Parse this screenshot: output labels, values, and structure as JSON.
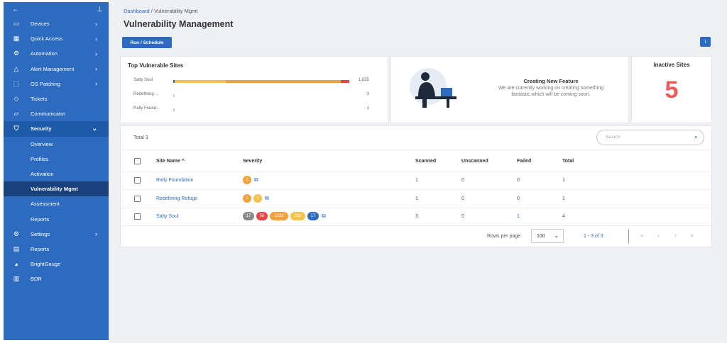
{
  "sidebar": {
    "items": [
      {
        "label": "Devices",
        "icon": "monitor-icon",
        "glyph": "▭",
        "chevron": true
      },
      {
        "label": "Quick Access",
        "icon": "grid-icon",
        "glyph": "▦",
        "chevron": true
      },
      {
        "label": "Automation",
        "icon": "automation-icon",
        "glyph": "⚙",
        "chevron": true
      },
      {
        "label": "Alert Management",
        "icon": "warning-icon",
        "glyph": "△",
        "chevron": true
      },
      {
        "label": "OS Patching",
        "icon": "patch-icon",
        "glyph": "⬚",
        "chevron": true
      },
      {
        "label": "Tickets",
        "icon": "ticket-icon",
        "glyph": "◇",
        "chevron": false
      },
      {
        "label": "Communicator",
        "icon": "chat-icon",
        "glyph": "▱",
        "chevron": false
      }
    ],
    "security": {
      "label": "Security",
      "icon": "shield-icon",
      "glyph": "⛉"
    },
    "security_sub": [
      "Overview",
      "Profiles",
      "Activation",
      "Vulnerability Mgmt",
      "Assessment",
      "Reports"
    ],
    "bottom_items": [
      {
        "label": "Settings",
        "icon": "settings-icon",
        "glyph": "⚙",
        "chevron": true
      },
      {
        "label": "Reports",
        "icon": "report-icon",
        "glyph": "▤",
        "chevron": false
      },
      {
        "label": "BrightGauge",
        "icon": "gauge-icon",
        "glyph": "◕",
        "chevron": false
      },
      {
        "label": "BDR",
        "icon": "backup-icon",
        "glyph": "▥",
        "chevron": false
      }
    ]
  },
  "breadcrumb": {
    "home": "Dashboard",
    "separator": "/",
    "current": "Vulnerability Mgmt"
  },
  "page_title": "Vulnerability Management",
  "run_button": "Run / Schedule",
  "info_button": "i",
  "top_sites": {
    "title": "Top Vulnerable Sites",
    "rows": [
      {
        "label": "Salty Soul",
        "value": "1,655",
        "segments": [
          {
            "color": "#2c6bbf",
            "frac": 0.01
          },
          {
            "color": "#f5c24a",
            "frac": 0.29
          },
          {
            "color": "#f2a13e",
            "frac": 0.65
          },
          {
            "color": "#e84545",
            "frac": 0.05
          }
        ],
        "width_frac": 1.0
      },
      {
        "label": "Redefining ...",
        "value": "3",
        "segments": [
          {
            "color": "#cccccc",
            "frac": 1
          }
        ],
        "width_frac": 0.004
      },
      {
        "label": "Rally Found...",
        "value": "1",
        "segments": [
          {
            "color": "#cccccc",
            "frac": 1
          }
        ],
        "width_frac": 0.004
      }
    ]
  },
  "feature": {
    "title": "Creating New Feature",
    "line1": "We are currently working on creating something",
    "line2": "fantastic which will be coming soon."
  },
  "inactive": {
    "title": "Inactive Sites",
    "count": "5"
  },
  "table": {
    "total": "Total 3",
    "search_placeholder": "Search",
    "headers": {
      "site": "Site Name",
      "sort": "^",
      "severity": "Severity",
      "scanned": "Scanned",
      "unscanned": "Unscanned",
      "failed": "Failed",
      "total": "Total"
    },
    "rows": [
      {
        "site": "Rally Foundation",
        "pills": [
          {
            "text": "1",
            "color": "#f2a13e"
          }
        ],
        "scanned": "1",
        "unscanned": "0",
        "failed": "0",
        "total": "1"
      },
      {
        "site": "Redefining Refuge",
        "pills": [
          {
            "text": "2",
            "color": "#f2a13e"
          },
          {
            "text": "1",
            "color": "#f5c24a"
          }
        ],
        "scanned": "1",
        "unscanned": "0",
        "failed": "0",
        "total": "1"
      },
      {
        "site": "Salty Soul",
        "pills": [
          {
            "text": "17",
            "color": "#8a8a8a"
          },
          {
            "text": "56",
            "color": "#e84545"
          },
          {
            "text": "1232",
            "color": "#f2a13e"
          },
          {
            "text": "331",
            "color": "#f5c24a"
          },
          {
            "text": "17",
            "color": "#2c6bbf"
          }
        ],
        "scanned": "3",
        "unscanned": "0",
        "failed": "1",
        "total": "4"
      }
    ],
    "footer": {
      "rows_per_page_label": "Rows per page",
      "rows_per_page": "100",
      "range": "1 - 3 of 3"
    }
  },
  "colors": {
    "accent": "#2c6bbf",
    "danger": "#ee5b5b"
  }
}
